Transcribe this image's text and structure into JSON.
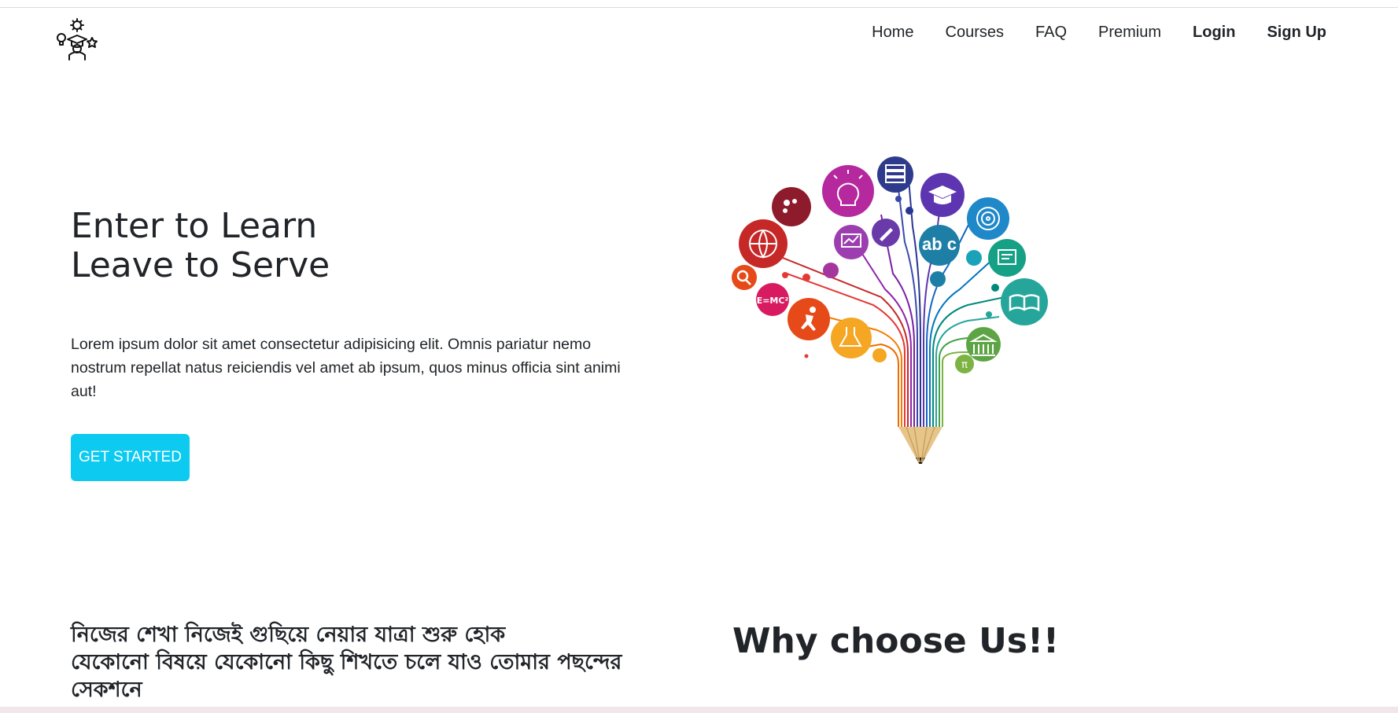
{
  "navbar": {
    "logo_icon": "education-bulb-graduate-icon",
    "links": [
      {
        "label": "Home"
      },
      {
        "label": "Courses"
      },
      {
        "label": "FAQ"
      },
      {
        "label": "Premium"
      },
      {
        "label": "Login"
      },
      {
        "label": "Sign Up"
      }
    ]
  },
  "hero": {
    "title_line1": "Enter to Learn",
    "title_line2": "Leave to Serve",
    "description": "Lorem ipsum dolor sit amet consectetur adipisicing elit. Omnis pariatur nemo nostrum repellat natus reiciendis vel amet ab ipsum, quos minus officia sint animi aut!",
    "cta_label": "GET STARTED",
    "cta_color": "#0dcaf0",
    "illustration": {
      "icon": "pencil-knowledge-tree-icon",
      "labels": {
        "formula": "E=MC²",
        "letters": "ab c",
        "pi": "π",
        "idea": "idea"
      }
    }
  },
  "section": {
    "bangla_line1": "নিজের শেখা নিজেই গুছিয়ে নেয়ার যাত্রা শুরু হোক",
    "bangla_line2": "যেকোনো বিষয়ে যেকোনো কিছু শিখতে চলে যাও তোমার পছন্দের সেকশনে",
    "why_title": "Why choose Us!!"
  }
}
